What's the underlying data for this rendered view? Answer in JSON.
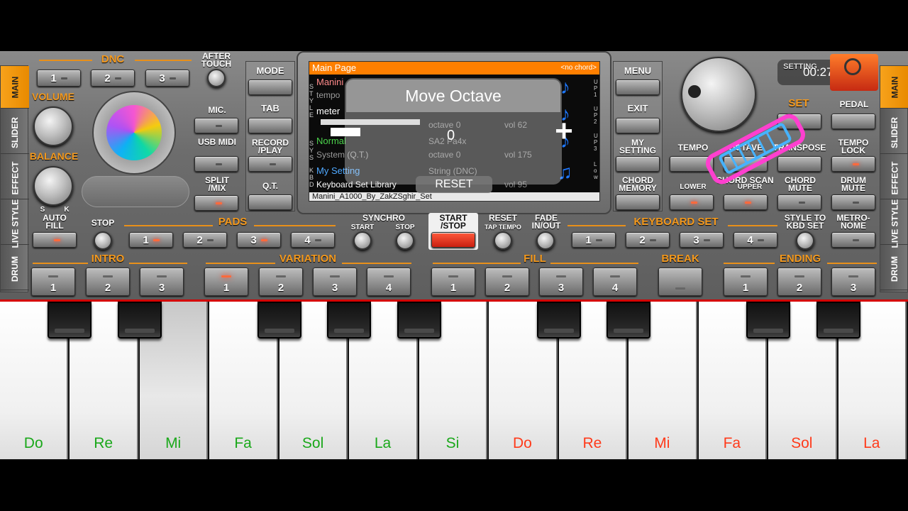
{
  "side_tabs_left": [
    "MAIN",
    "SLIDER",
    "EFFECT",
    "LIVE STYLE",
    "DRUM"
  ],
  "side_tabs_right": [
    "MAIN",
    "SLIDER",
    "EFFECT",
    "LIVE STYLE",
    "DRUM"
  ],
  "dnc": {
    "title": "DNC",
    "buttons": [
      "1",
      "2",
      "3"
    ]
  },
  "after_touch": "AFTER TOUCH",
  "volume": "VOLUME",
  "balance": "BALANCE",
  "balance_marks": [
    "S",
    "K"
  ],
  "mic": "MIC.",
  "usb_midi": "USB MIDI",
  "split_mix": "SPLIT /MIX",
  "left_col": {
    "mode": "MODE",
    "tab": "TAB",
    "record_play": "RECORD /PLAY",
    "qt": "Q.T."
  },
  "right_col": {
    "menu": "MENU",
    "exit": "EXIT",
    "my_setting": "MY SETTING",
    "chord_memory": "CHORD MEMORY"
  },
  "screen": {
    "header": "Main Page",
    "chord": "<no chord>",
    "style_name": "Manini",
    "tempo": "tempo",
    "meter": "meter",
    "normal": "Normal",
    "system_qt": "System (Q.T.)",
    "my_setting": "My Setting",
    "kbd_lib": "Keyboard Set Library",
    "footer": "Manini_A1000_By_ZakZSghir_Set",
    "octave_a": "octave 0",
    "vol_a": "vol 62",
    "voice_b": "SA2 Pa4x",
    "octave_b": "octave 0",
    "vol_b": "vol 175",
    "voice_c": "String (DNC)",
    "vol_c": "vol 95",
    "left_side_s": "S T Y L E",
    "left_side_sys": "S Y S",
    "left_side_kbd": "K B D",
    "right_side_up1": "U P 1",
    "right_side_up2": "U P 2",
    "right_side_up3": "U P 3",
    "right_side_low": "L o w"
  },
  "popup": {
    "title": "Move Octave",
    "value": "0",
    "reset": "RESET"
  },
  "top_right": {
    "setting": "SETTING",
    "timer": "00:27",
    "set_label": "SET"
  },
  "labels": {
    "tempo": "TEMPO",
    "octave": "OCTAVE",
    "transpose": "TRANSPOSE",
    "pedal": "PEDAL",
    "tempo_lock": "TEMPO LOCK",
    "lower": "LOWER",
    "chord_scan": "CHORD SCAN",
    "upper": "UPPER",
    "chord_mute": "CHORD MUTE",
    "drum_mute": "DRUM MUTE"
  },
  "row3": {
    "auto_fill": "AUTO FILL",
    "stop": "STOP",
    "pads": "PADS",
    "pad_buttons": [
      "1",
      "2",
      "3",
      "4"
    ],
    "synchro": "SYNCHRO",
    "synchro_start": "START",
    "synchro_stop": "STOP",
    "start_stop": "START /STOP",
    "reset": "RESET",
    "tap_tempo": "TAP TEMPO",
    "fade": "FADE IN/OUT",
    "keyboard_set": "KEYBOARD SET",
    "kbd_buttons": [
      "1",
      "2",
      "3",
      "4"
    ],
    "style_to_kbd": "STYLE TO KBD SET",
    "metronome": "METRO- NOME"
  },
  "row4": {
    "intro": "INTRO",
    "intro_buttons": [
      "1",
      "2",
      "3"
    ],
    "variation": "VARIATION",
    "variation_buttons": [
      "1",
      "2",
      "3",
      "4"
    ],
    "fill": "FILL",
    "fill_buttons": [
      "1",
      "2",
      "3",
      "4"
    ],
    "break": "BREAK",
    "ending": "ENDING",
    "ending_buttons": [
      "1",
      "2",
      "3"
    ]
  },
  "keys": {
    "white": [
      {
        "note": "Do",
        "color": "#1aa81a"
      },
      {
        "note": "Re",
        "color": "#1aa81a"
      },
      {
        "note": "Mi",
        "color": "#1aa81a"
      },
      {
        "note": "Fa",
        "color": "#1aa81a"
      },
      {
        "note": "Sol",
        "color": "#1aa81a"
      },
      {
        "note": "La",
        "color": "#1aa81a"
      },
      {
        "note": "Si",
        "color": "#1aa81a"
      },
      {
        "note": "Do",
        "color": "#ff3a1a"
      },
      {
        "note": "Re",
        "color": "#ff3a1a"
      },
      {
        "note": "Mi",
        "color": "#ff3a1a"
      },
      {
        "note": "Fa",
        "color": "#ff3a1a"
      },
      {
        "note": "Sol",
        "color": "#ff3a1a"
      },
      {
        "note": "La",
        "color": "#ff3a1a"
      }
    ],
    "pressed_index": 2
  },
  "colors": {
    "accent": "#f59a1e",
    "screen_header": "#ff7f00",
    "lit_led": "#ff3b1e"
  }
}
